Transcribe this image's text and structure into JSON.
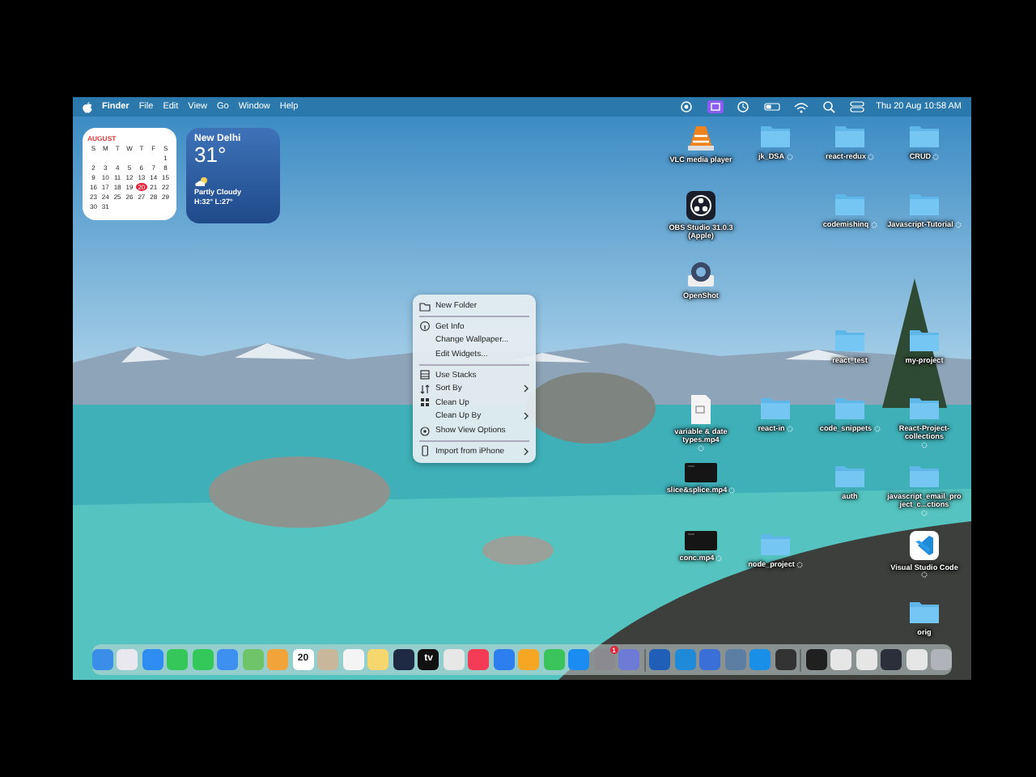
{
  "menu_bar": {
    "app": "Finder",
    "menus": [
      "File",
      "Edit",
      "View",
      "Go",
      "Window",
      "Help"
    ],
    "clock": "Thu 20 Aug  10:58 AM"
  },
  "calendar_widget": {
    "month": "AUGUST",
    "weekdays": [
      "S",
      "M",
      "T",
      "W",
      "T",
      "F",
      "S"
    ],
    "weeks": [
      [
        {
          "day": "1",
          "today": false
        }
      ],
      [
        {
          "day": "2",
          "today": false
        },
        {
          "day": "3",
          "today": false
        },
        {
          "day": "4",
          "today": false
        },
        {
          "day": "5",
          "today": false
        },
        {
          "day": "6",
          "today": false
        },
        {
          "day": "7",
          "today": false
        },
        {
          "day": "8",
          "today": false
        }
      ],
      [
        {
          "day": "9",
          "today": false
        },
        {
          "day": "10",
          "today": false
        },
        {
          "day": "11",
          "today": false
        },
        {
          "day": "12",
          "today": false
        },
        {
          "day": "13",
          "today": false
        },
        {
          "day": "14",
          "today": false
        },
        {
          "day": "15",
          "today": false
        }
      ],
      [
        {
          "day": "16",
          "today": false
        },
        {
          "day": "17",
          "today": false
        },
        {
          "day": "18",
          "today": false
        },
        {
          "day": "19",
          "today": false
        },
        {
          "day": "20",
          "today": true
        },
        {
          "day": "21",
          "today": false
        },
        {
          "day": "22",
          "today": false
        }
      ],
      [
        {
          "day": "23",
          "today": false
        },
        {
          "day": "24",
          "today": false
        },
        {
          "day": "25",
          "today": false
        },
        {
          "day": "26",
          "today": false
        },
        {
          "day": "27",
          "today": false
        },
        {
          "day": "28",
          "today": false
        },
        {
          "day": "29",
          "today": false
        }
      ],
      [
        {
          "day": "30",
          "today": false
        },
        {
          "day": "31",
          "today": false
        }
      ]
    ]
  },
  "weather_widget": {
    "city": "New Delhi",
    "temperature": "31°",
    "condition": "Partly Cloudy",
    "range": "H:32° L:27°"
  },
  "context_menu": {
    "sections": [
      [
        {
          "label": "New Folder",
          "submenu": false
        }
      ],
      [
        {
          "label": "Get Info",
          "submenu": false
        },
        {
          "label": "Change Wallpaper...",
          "submenu": false
        },
        {
          "label": "Edit Widgets...",
          "submenu": false
        }
      ],
      [
        {
          "label": "Use Stacks",
          "submenu": false
        },
        {
          "label": "Sort By",
          "submenu": true
        },
        {
          "label": "Clean Up",
          "submenu": false
        },
        {
          "label": "Clean Up By",
          "submenu": true
        },
        {
          "label": "Show View Options",
          "submenu": false
        }
      ],
      [
        {
          "label": "Import from iPhone",
          "submenu": true
        }
      ]
    ]
  },
  "desktop_items": [
    {
      "label": "VLC media player",
      "kind": "vlc",
      "synced": false
    },
    {
      "label": "jk_DSA",
      "kind": "folder",
      "synced": true
    },
    {
      "label": "react-redux",
      "kind": "folder",
      "synced": true
    },
    {
      "label": "CRUD",
      "kind": "folder",
      "synced": true
    },
    {
      "label": "OBS Studio 31.0.3 (Apple)",
      "kind": "obs",
      "synced": false
    },
    {
      "label": "codemishinq",
      "kind": "folder",
      "synced": true
    },
    {
      "label": "Javascript-Tutorial",
      "kind": "folder",
      "synced": true
    },
    {
      "label": "OpenShot",
      "kind": "openshot",
      "synced": false
    },
    {
      "label": "react_test",
      "kind": "folder",
      "synced": false
    },
    {
      "label": "my-project",
      "kind": "folder",
      "synced": false
    },
    {
      "label": "variable & date types.mp4",
      "kind": "video",
      "synced": true
    },
    {
      "label": "react-in",
      "kind": "folder",
      "synced": true
    },
    {
      "label": "code_snippets",
      "kind": "folder",
      "synced": true
    },
    {
      "label": "React-Project-collections",
      "kind": "folder",
      "synced": true
    },
    {
      "label": "slice&splice.mp4",
      "kind": "clip",
      "synced": true
    },
    {
      "label": "auth",
      "kind": "folder",
      "synced": false
    },
    {
      "label": "javascript_email_project_c...ctions",
      "kind": "folder",
      "synced": true
    },
    {
      "label": "conc.mp4",
      "kind": "clip",
      "synced": true
    },
    {
      "label": "node_project",
      "kind": "folder",
      "synced": true
    },
    {
      "label": "Visual Studio Code",
      "kind": "vscode",
      "synced": true
    },
    {
      "label": "orig",
      "kind": "folder",
      "synced": false
    }
  ],
  "dock": [
    {
      "color": "#3b8ee8"
    },
    {
      "color": "#e8e8ee"
    },
    {
      "color": "#2f8cf0"
    },
    {
      "color": "#35c759"
    },
    {
      "color": "#34c759"
    },
    {
      "color": "#3d8ff0"
    },
    {
      "color": "#6fc46a"
    },
    {
      "color": "#f2a33a"
    },
    {
      "color": "#ffffff",
      "text": "20"
    },
    {
      "color": "#c9b79c"
    },
    {
      "color": "#f4f4f4"
    },
    {
      "color": "#f5d76e"
    },
    {
      "color": "#1e2a44"
    },
    {
      "color": "#111111",
      "text": "tv"
    },
    {
      "color": "#e7e7e7"
    },
    {
      "color": "#f43b55"
    },
    {
      "color": "#2d7ff0"
    },
    {
      "color": "#f5a623"
    },
    {
      "color": "#3bc45c"
    },
    {
      "color": "#1b8df2"
    },
    {
      "color": "#8a8a90",
      "badge": "1"
    },
    {
      "color": "#6e7bd6"
    },
    {
      "color": "#1f5fb8"
    },
    {
      "color": "#1f8ad8"
    },
    {
      "color": "#3a6fd8"
    },
    {
      "color": "#5c7ea3"
    },
    {
      "color": "#1a8fe8"
    },
    {
      "color": "#333333"
    },
    {
      "color": "#202020"
    },
    {
      "color": "#e6e6e6"
    },
    {
      "color": "#e6e6e6"
    },
    {
      "color": "#2a2f3a"
    },
    {
      "color": "#e6e6e6"
    },
    {
      "color": "#b0b4ba"
    }
  ]
}
